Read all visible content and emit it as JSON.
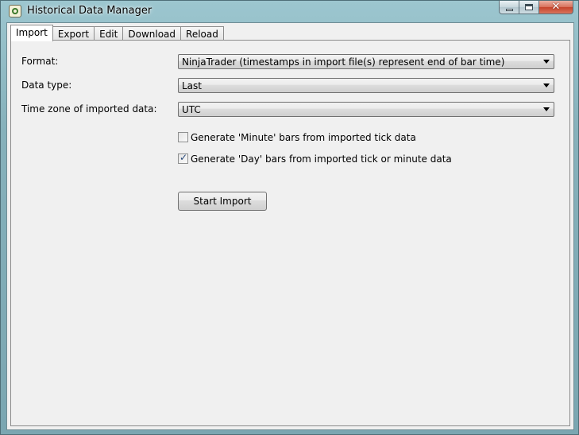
{
  "window": {
    "title": "Historical Data Manager",
    "minimize_glyph": "",
    "maximize_glyph": "",
    "close_glyph": "✕"
  },
  "tabs": [
    "Import",
    "Export",
    "Edit",
    "Download",
    "Reload"
  ],
  "active_tab": "Import",
  "import": {
    "format_label": "Format:",
    "format_value": "NinjaTrader (timestamps in import file(s) represent end of bar time)",
    "datatype_label": "Data type:",
    "datatype_value": "Last",
    "timezone_label": "Time zone of imported data:",
    "timezone_value": "UTC",
    "gen_minute_label": "Generate 'Minute' bars from imported tick data",
    "gen_minute_checked": false,
    "gen_day_label": "Generate 'Day' bars from imported tick or minute data",
    "gen_day_checked": true,
    "start_button": "Start Import"
  },
  "icons": {
    "app": "ninjatrader-app-icon",
    "dropdown": "chevron-down-icon",
    "check": "checkmark-icon"
  }
}
